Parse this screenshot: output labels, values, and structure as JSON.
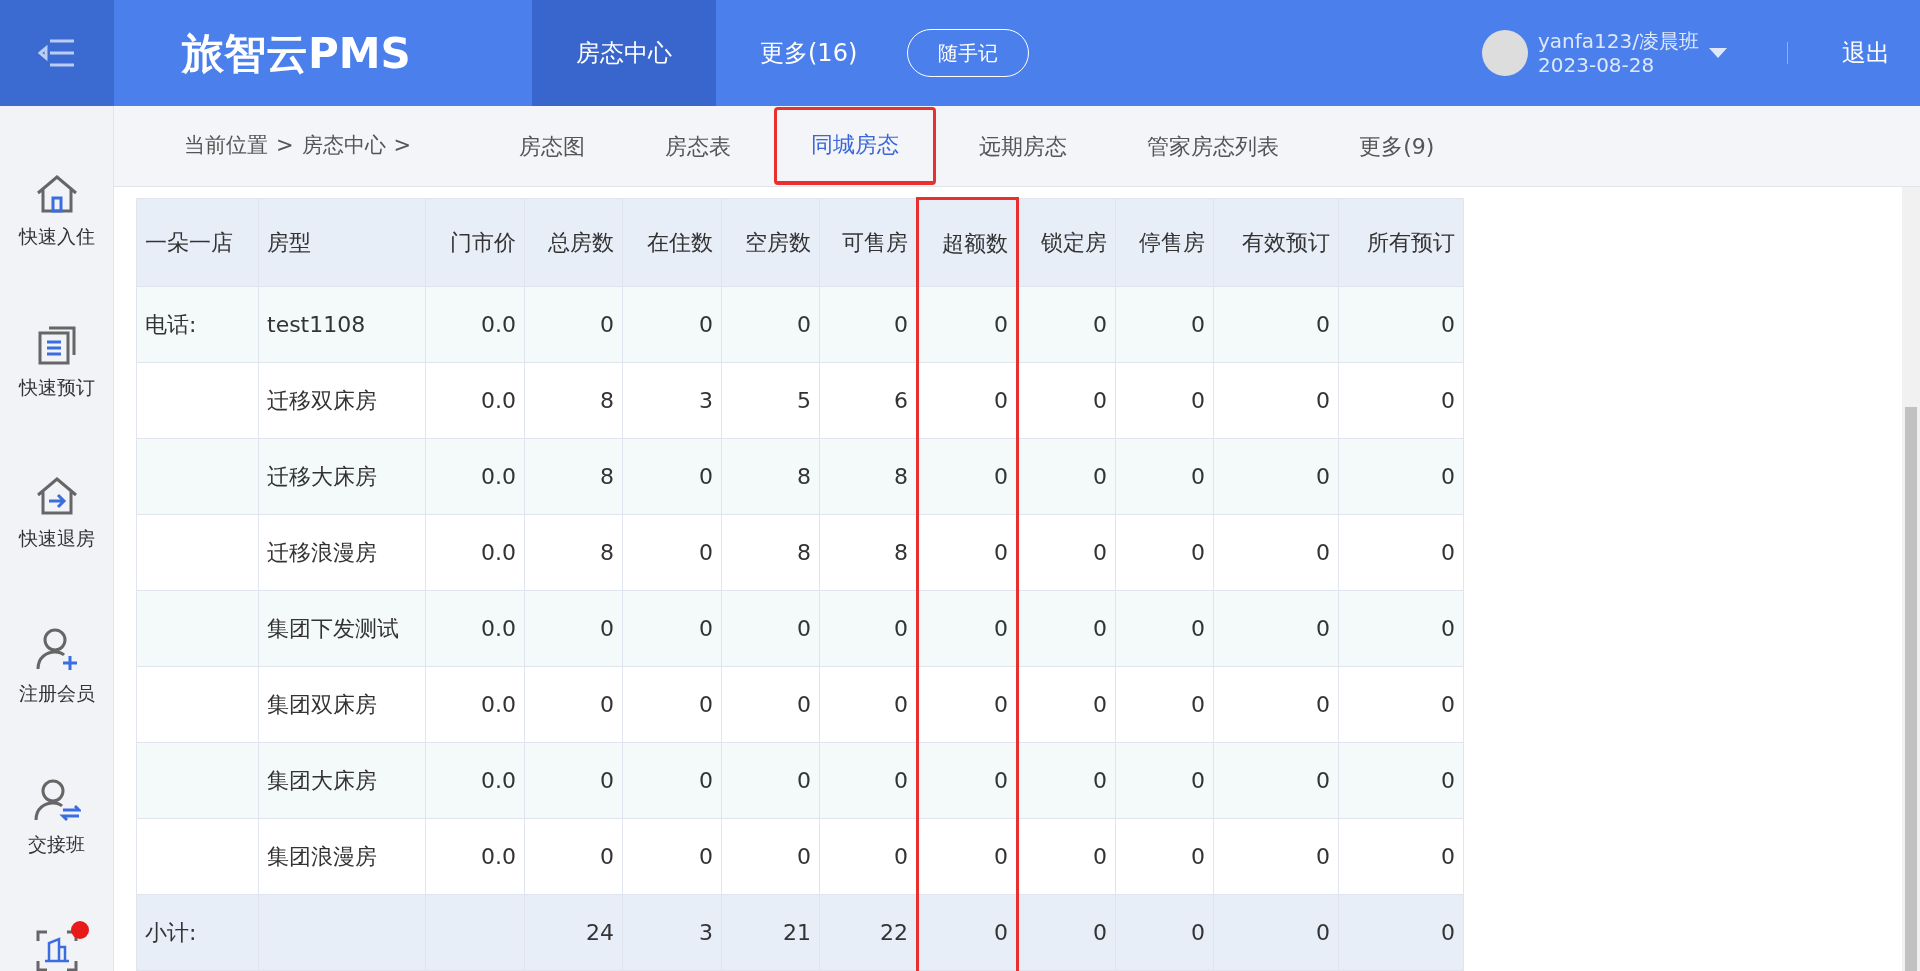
{
  "header": {
    "logo": "旅智云PMS",
    "nav": [
      {
        "label": "房态中心",
        "selected": true
      },
      {
        "label": "更多(16)",
        "selected": false
      }
    ],
    "note_button": "随手记",
    "user": {
      "name": "yanfa123/凌晨班",
      "date": "2023-08-28"
    },
    "logout": "退出"
  },
  "sidebar": {
    "items": [
      {
        "label": "快速入住",
        "badge": false
      },
      {
        "label": "快速预订",
        "badge": false
      },
      {
        "label": "快速退房",
        "badge": false
      },
      {
        "label": "注册会员",
        "badge": false
      },
      {
        "label": "交接班",
        "badge": false
      },
      {
        "badge": true
      }
    ]
  },
  "breadcrumb": [
    {
      "label": "当前位置",
      "separator": ">"
    },
    {
      "label": "房态中心",
      "separator": ">"
    }
  ],
  "tabs": [
    {
      "label": "房态图",
      "selected": false,
      "highlighted": false
    },
    {
      "label": "房态表",
      "selected": false,
      "highlighted": false
    },
    {
      "label": "同城房态",
      "selected": true,
      "highlighted": true
    },
    {
      "label": "远期房态",
      "selected": false,
      "highlighted": false
    },
    {
      "label": "管家房态列表",
      "selected": false,
      "highlighted": false
    },
    {
      "label": "更多(9)",
      "selected": false,
      "highlighted": false
    }
  ],
  "table": {
    "columns": [
      {
        "label": "一朵一店",
        "highlighted": false
      },
      {
        "label": "房型",
        "highlighted": false
      },
      {
        "label": "门市价",
        "highlighted": false
      },
      {
        "label": "总房数",
        "highlighted": false
      },
      {
        "label": "在住数",
        "highlighted": false
      },
      {
        "label": "空房数",
        "highlighted": false
      },
      {
        "label": "可售房",
        "highlighted": false
      },
      {
        "label": "超额数",
        "highlighted": true
      },
      {
        "label": "锁定房",
        "highlighted": false
      },
      {
        "label": "停售房",
        "highlighted": false
      },
      {
        "label": "有效预订",
        "highlighted": false
      },
      {
        "label": "所有预订",
        "highlighted": false
      }
    ],
    "rows": [
      [
        "电话:",
        "test1108",
        "0.0",
        "0",
        "0",
        "0",
        "0",
        "0",
        "0",
        "0",
        "0",
        "0"
      ],
      [
        null,
        "迁移双床房",
        "0.0",
        "8",
        "3",
        "5",
        "6",
        "0",
        "0",
        "0",
        "0",
        "0"
      ],
      [
        null,
        "迁移大床房",
        "0.0",
        "8",
        "0",
        "8",
        "8",
        "0",
        "0",
        "0",
        "0",
        "0"
      ],
      [
        null,
        "迁移浪漫房",
        "0.0",
        "8",
        "0",
        "8",
        "8",
        "0",
        "0",
        "0",
        "0",
        "0"
      ],
      [
        null,
        "集团下发测试",
        "0.0",
        "0",
        "0",
        "0",
        "0",
        "0",
        "0",
        "0",
        "0",
        "0"
      ],
      [
        null,
        "集团双床房",
        "0.0",
        "0",
        "0",
        "0",
        "0",
        "0",
        "0",
        "0",
        "0",
        "0"
      ],
      [
        null,
        "集团大床房",
        "0.0",
        "0",
        "0",
        "0",
        "0",
        "0",
        "0",
        "0",
        "0",
        "0"
      ],
      [
        null,
        "集团浪漫房",
        "0.0",
        "0",
        "0",
        "0",
        "0",
        "0",
        "0",
        "0",
        "0",
        "0"
      ]
    ],
    "subtotal": {
      "label": "小计:",
      "values": [
        "24",
        "3",
        "21",
        "22",
        "0",
        "0",
        "0",
        "0",
        "0"
      ]
    }
  }
}
